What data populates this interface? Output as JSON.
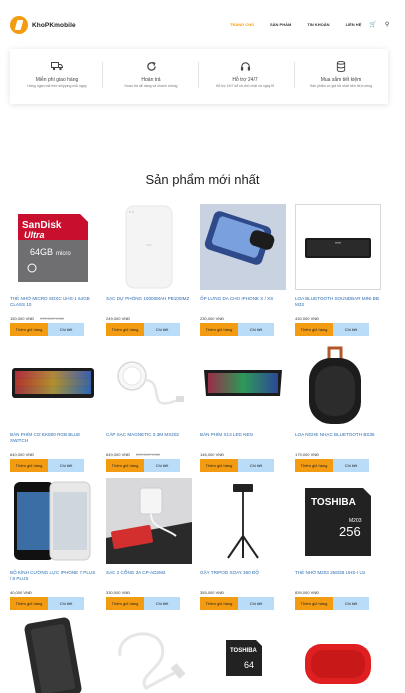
{
  "header": {
    "logo_text": "KhoPKmobile",
    "nav": [
      "TRANG CHỦ",
      "SẢN PHẨM",
      "TIN KHOẢN",
      "LIÊN HỆ"
    ],
    "active_index": 0
  },
  "services": [
    {
      "title": "Miễn phí giao hàng",
      "desc": "Hàng ngàn mã free shipping mỗi ngày",
      "icon": "truck-icon"
    },
    {
      "title": "Hoàn trả",
      "desc": "Hoàn trả dễ dàng và nhanh chóng",
      "icon": "refresh-icon"
    },
    {
      "title": "Hỗ trợ 24/7",
      "desc": "Hỗ trợ 24/7 kể cả chủ nhật và ngày lễ",
      "icon": "headset-icon"
    },
    {
      "title": "Mua sắm tiết kiệm",
      "desc": "Sản phẩm có giá tốt nhất trên thị trường",
      "icon": "database-icon"
    }
  ],
  "section_title": "Sản phẩm mới nhất",
  "buttons": {
    "add_to_cart": "Thêm giỏ hàng",
    "detail": "Chi tiết"
  },
  "products": [
    {
      "name": "THẺ NHỚ MICRO SDXC UHS-1 64GB CLASS 10",
      "price": "150,000 VNĐ",
      "old_price": "170,000 VNĐ"
    },
    {
      "name": "SẠC DỰ PHÒNG 10000MAH PB100IMZ",
      "price": "249,000 VNĐ",
      "old_price": ""
    },
    {
      "name": "ỐP LƯNG DA CHO IPHONE X / XS",
      "price": "230,000 VNĐ",
      "old_price": ""
    },
    {
      "name": "LOA BLUETOOTH SOUNDBAR MINI BB M33",
      "price": "430,000 VNĐ",
      "old_price": ""
    },
    {
      "name": "BÀN PHÍM CƠ EK800 RGB BLUE SWITCH",
      "price": "640,000 VNĐ",
      "old_price": ""
    },
    {
      "name": "CÁP SẠC MAGNETIC 0.3M MX202",
      "price": "649,000 VNĐ",
      "old_price": "220,000 VNĐ"
    },
    {
      "name": "BÀN PHÍM X13 LED NEN",
      "price": "146,000 VNĐ",
      "old_price": ""
    },
    {
      "name": "LOA NGHE NHẠC BLUETOOTH BS35",
      "price": "179,000 VNĐ",
      "old_price": ""
    },
    {
      "name": "BỘ KÍNH CƯỜNG LỰC IPHONE 7 PLUS / 8 PLUS",
      "price": "40,000 VNĐ",
      "old_price": ""
    },
    {
      "name": "SẠC 2 CỔNG 3A CP-AD2M2",
      "price": "330,000 VNĐ",
      "old_price": ""
    },
    {
      "name": "GẬY TRIPOD XOAY 360 ĐỘ",
      "price": "355,000 VNĐ",
      "old_price": ""
    },
    {
      "name": "THẺ NHỚ M203 256GB UHS-I U1",
      "price": "839,000 VNĐ",
      "old_price": ""
    },
    {
      "name": "",
      "price": "",
      "old_price": ""
    },
    {
      "name": "",
      "price": "",
      "old_price": ""
    },
    {
      "name": "",
      "price": "",
      "old_price": ""
    },
    {
      "name": "",
      "price": "",
      "old_price": ""
    }
  ],
  "image_text": {
    "sd_brand": "SanDisk",
    "sd_line": "Ultra",
    "sd_cap": "64GB",
    "sd_micro": "micro",
    "toshiba": "TOSHIBA",
    "toshiba_model": "M203",
    "toshiba_cap": "256",
    "toshiba_small": "TOSHIBA",
    "toshiba_small_cap": "64"
  }
}
